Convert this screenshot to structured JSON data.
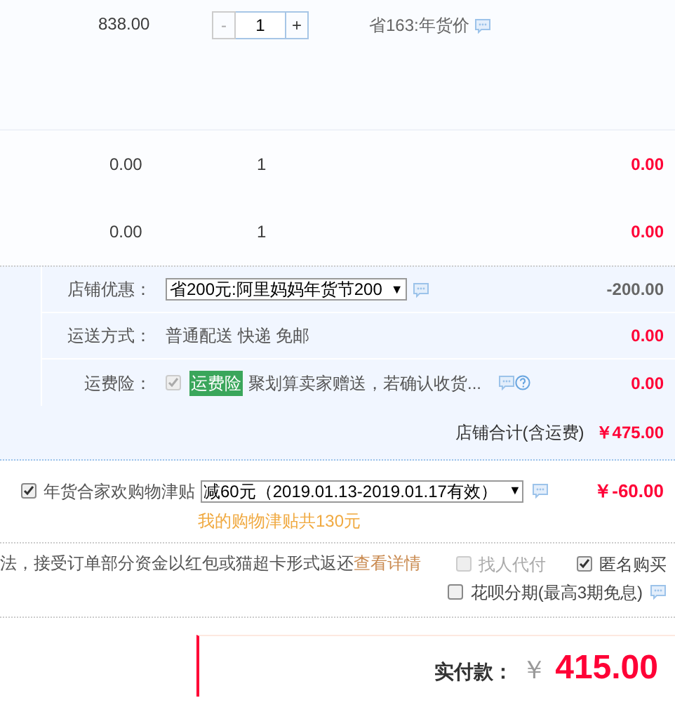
{
  "items": [
    {
      "kind": "stepper",
      "price": "838.00",
      "minus": "-",
      "quantity": "1",
      "plus": "+",
      "promo": "省163:年货价"
    },
    {
      "kind": "plain",
      "price": "0.00",
      "quantity": "1",
      "subtotal": "0.00"
    },
    {
      "kind": "plain",
      "price": "0.00",
      "quantity": "1",
      "subtotal": "0.00"
    }
  ],
  "shop_rows": [
    {
      "kind": "select",
      "label": "店铺优惠：",
      "value": "省200元:阿里妈妈年货节200",
      "arrow": "▼",
      "amount": "-200.00",
      "highlight": false
    },
    {
      "kind": "text",
      "label": "运送方式：",
      "value": "普通配送 快递 免邮",
      "amount": "0.00",
      "highlight": true
    },
    {
      "kind": "insurance",
      "label": "运费险：",
      "checked": true,
      "disabled": true,
      "tag": "运费险",
      "value": "聚划算卖家赠送，若确认收货...",
      "amount": "0.00",
      "highlight": true
    }
  ],
  "shop_total": {
    "label": "店铺合计(含运费)",
    "amount": "￥475.00"
  },
  "allowance": {
    "checked": true,
    "label": "年货合家欢购物津贴",
    "value": "减60元（2019.01.13-2019.01.17有效）",
    "arrow": "▼",
    "amount": "￥-60.00",
    "note": "我的购物津贴共130元"
  },
  "notice": {
    "text": "法，接受订单部分资金以红包或猫超卡形式返还",
    "link": "查看详情"
  },
  "options": [
    {
      "label": "找人代付",
      "checked": false,
      "disabled": true
    },
    {
      "label": "匿名购买",
      "checked": true,
      "disabled": false
    },
    {
      "label": "花呗分期(最高3期免息)",
      "checked": false,
      "disabled": false
    }
  ],
  "payment": {
    "label": "实付款：",
    "currency": "￥",
    "amount": "415.00"
  }
}
